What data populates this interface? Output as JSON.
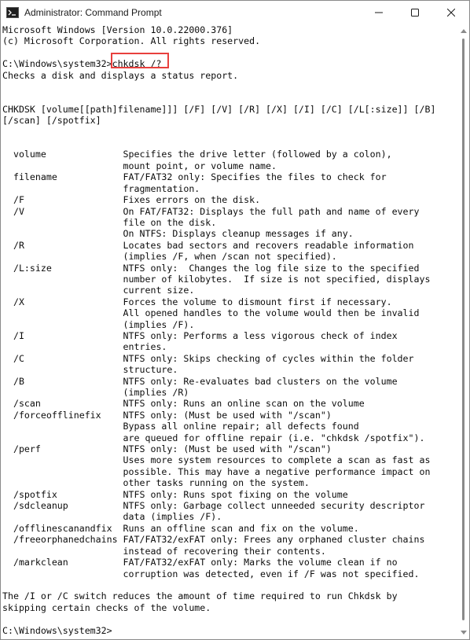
{
  "window": {
    "title": "Administrator: Command Prompt",
    "icon": "cmd-icon",
    "controls": {
      "minimize_icon": "minimize-icon",
      "maximize_icon": "maximize-icon",
      "close_icon": "close-icon"
    }
  },
  "highlight": {
    "text": "chkdsk /?",
    "color": "#e8403d"
  },
  "console": {
    "lines": [
      "Microsoft Windows [Version 10.0.22000.376]",
      "(c) Microsoft Corporation. All rights reserved.",
      "",
      "C:\\Windows\\system32>chkdsk /?",
      "Checks a disk and displays a status report.",
      "",
      "",
      "CHKDSK [volume[[path]filename]]] [/F] [/V] [/R] [/X] [/I] [/C] [/L[:size]] [/B]",
      "[/scan] [/spotfix]",
      "",
      "",
      "  volume              Specifies the drive letter (followed by a colon),",
      "                      mount point, or volume name.",
      "  filename            FAT/FAT32 only: Specifies the files to check for",
      "                      fragmentation.",
      "  /F                  Fixes errors on the disk.",
      "  /V                  On FAT/FAT32: Displays the full path and name of every",
      "                      file on the disk.",
      "                      On NTFS: Displays cleanup messages if any.",
      "  /R                  Locates bad sectors and recovers readable information",
      "                      (implies /F, when /scan not specified).",
      "  /L:size             NTFS only:  Changes the log file size to the specified",
      "                      number of kilobytes.  If size is not specified, displays",
      "                      current size.",
      "  /X                  Forces the volume to dismount first if necessary.",
      "                      All opened handles to the volume would then be invalid",
      "                      (implies /F).",
      "  /I                  NTFS only: Performs a less vigorous check of index",
      "                      entries.",
      "  /C                  NTFS only: Skips checking of cycles within the folder",
      "                      structure.",
      "  /B                  NTFS only: Re-evaluates bad clusters on the volume",
      "                      (implies /R)",
      "  /scan               NTFS only: Runs an online scan on the volume",
      "  /forceofflinefix    NTFS only: (Must be used with \"/scan\")",
      "                      Bypass all online repair; all defects found",
      "                      are queued for offline repair (i.e. \"chkdsk /spotfix\").",
      "  /perf               NTFS only: (Must be used with \"/scan\")",
      "                      Uses more system resources to complete a scan as fast as",
      "                      possible. This may have a negative performance impact on",
      "                      other tasks running on the system.",
      "  /spotfix            NTFS only: Runs spot fixing on the volume",
      "  /sdcleanup          NTFS only: Garbage collect unneeded security descriptor",
      "                      data (implies /F).",
      "  /offlinescanandfix  Runs an offline scan and fix on the volume.",
      "  /freeorphanedchains FAT/FAT32/exFAT only: Frees any orphaned cluster chains",
      "                      instead of recovering their contents.",
      "  /markclean          FAT/FAT32/exFAT only: Marks the volume clean if no",
      "                      corruption was detected, even if /F was not specified.",
      "",
      "The /I or /C switch reduces the amount of time required to run Chkdsk by",
      "skipping certain checks of the volume.",
      "",
      "C:\\Windows\\system32>"
    ]
  }
}
